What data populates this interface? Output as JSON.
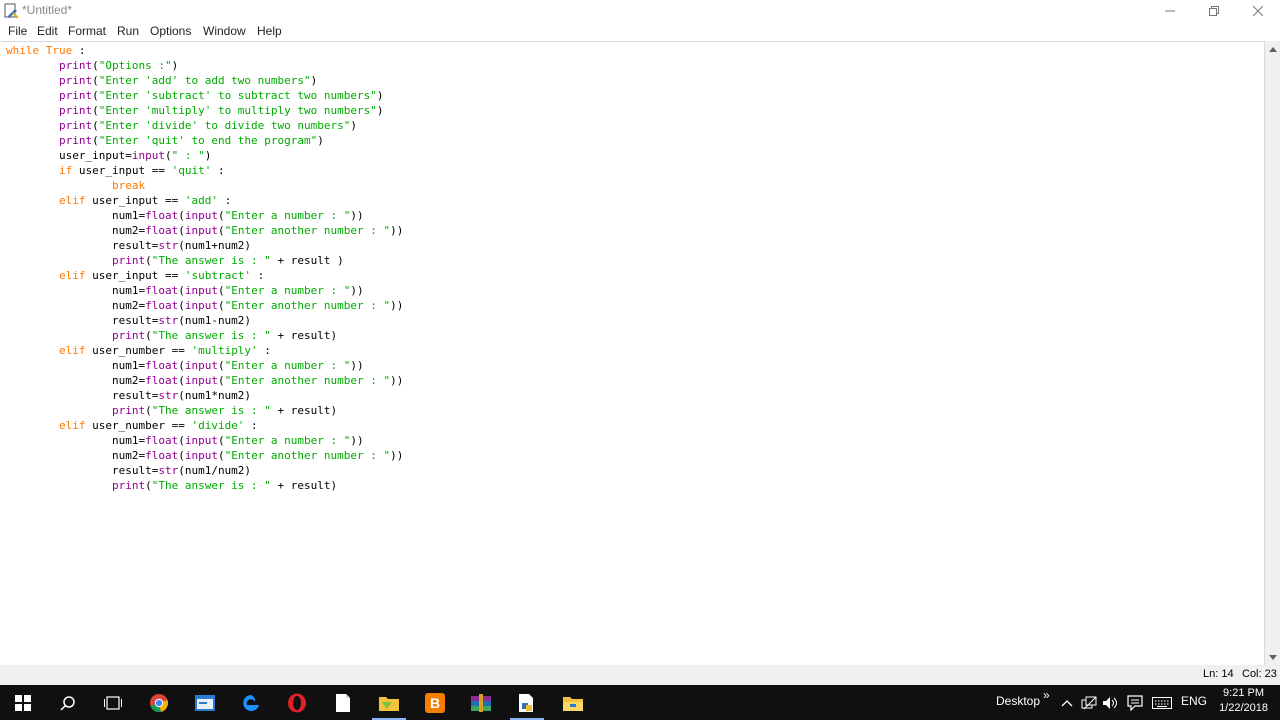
{
  "window": {
    "title": "*Untitled*"
  },
  "menu": [
    "File",
    "Edit",
    "Format",
    "Run",
    "Options",
    "Window",
    "Help"
  ],
  "code_lines": [
    [
      {
        "t": "while True",
        "c": "kw"
      },
      {
        "t": " :"
      }
    ],
    [
      {
        "t": "        "
      },
      {
        "t": "print",
        "c": "bi"
      },
      {
        "t": "("
      },
      {
        "t": "\"Options :\"",
        "c": "st"
      },
      {
        "t": ")"
      }
    ],
    [
      {
        "t": "        "
      },
      {
        "t": "print",
        "c": "bi"
      },
      {
        "t": "("
      },
      {
        "t": "\"Enter 'add' to add two numbers\"",
        "c": "st"
      },
      {
        "t": ")"
      }
    ],
    [
      {
        "t": "        "
      },
      {
        "t": "print",
        "c": "bi"
      },
      {
        "t": "("
      },
      {
        "t": "\"Enter 'subtract' to subtract two numbers\"",
        "c": "st"
      },
      {
        "t": ")"
      }
    ],
    [
      {
        "t": "        "
      },
      {
        "t": "print",
        "c": "bi"
      },
      {
        "t": "("
      },
      {
        "t": "\"Enter 'multiply' to multiply two numbers\"",
        "c": "st"
      },
      {
        "t": ")"
      }
    ],
    [
      {
        "t": "        "
      },
      {
        "t": "print",
        "c": "bi"
      },
      {
        "t": "("
      },
      {
        "t": "\"Enter 'divide' to divide two numbers\"",
        "c": "st"
      },
      {
        "t": ")"
      }
    ],
    [
      {
        "t": "        "
      },
      {
        "t": "print",
        "c": "bi"
      },
      {
        "t": "("
      },
      {
        "t": "\"Enter 'quit' to end the program\"",
        "c": "st"
      },
      {
        "t": ")"
      }
    ],
    [
      {
        "t": "        user_input="
      },
      {
        "t": "input",
        "c": "bi"
      },
      {
        "t": "("
      },
      {
        "t": "\" : \"",
        "c": "st"
      },
      {
        "t": ")"
      }
    ],
    [
      {
        "t": "        "
      },
      {
        "t": "if",
        "c": "kw"
      },
      {
        "t": " user_input == "
      },
      {
        "t": "'quit'",
        "c": "st"
      },
      {
        "t": " :"
      }
    ],
    [
      {
        "t": "                "
      },
      {
        "t": "break",
        "c": "kw"
      }
    ],
    [
      {
        "t": "        "
      },
      {
        "t": "elif",
        "c": "kw"
      },
      {
        "t": " user_input == "
      },
      {
        "t": "'add'",
        "c": "st"
      },
      {
        "t": " :"
      }
    ],
    [
      {
        "t": "                num1="
      },
      {
        "t": "float",
        "c": "bi"
      },
      {
        "t": "("
      },
      {
        "t": "input",
        "c": "bi"
      },
      {
        "t": "("
      },
      {
        "t": "\"Enter a number : \"",
        "c": "st"
      },
      {
        "t": "))"
      }
    ],
    [
      {
        "t": "                num2="
      },
      {
        "t": "float",
        "c": "bi"
      },
      {
        "t": "("
      },
      {
        "t": "input",
        "c": "bi"
      },
      {
        "t": "("
      },
      {
        "t": "\"Enter another number : \"",
        "c": "st"
      },
      {
        "t": "))"
      }
    ],
    [
      {
        "t": "                result="
      },
      {
        "t": "str",
        "c": "bi"
      },
      {
        "t": "(num1+num2)"
      }
    ],
    [
      {
        "t": "                "
      },
      {
        "t": "print",
        "c": "bi"
      },
      {
        "t": "("
      },
      {
        "t": "\"The answer is : \"",
        "c": "st"
      },
      {
        "t": " + result )"
      }
    ],
    [
      {
        "t": "        "
      },
      {
        "t": "elif",
        "c": "kw"
      },
      {
        "t": " user_input == "
      },
      {
        "t": "'subtract'",
        "c": "st"
      },
      {
        "t": " :"
      }
    ],
    [
      {
        "t": "                num1="
      },
      {
        "t": "float",
        "c": "bi"
      },
      {
        "t": "("
      },
      {
        "t": "input",
        "c": "bi"
      },
      {
        "t": "("
      },
      {
        "t": "\"Enter a number : \"",
        "c": "st"
      },
      {
        "t": "))"
      }
    ],
    [
      {
        "t": "                num2="
      },
      {
        "t": "float",
        "c": "bi"
      },
      {
        "t": "("
      },
      {
        "t": "input",
        "c": "bi"
      },
      {
        "t": "("
      },
      {
        "t": "\"Enter another number : \"",
        "c": "st"
      },
      {
        "t": "))"
      }
    ],
    [
      {
        "t": "                result="
      },
      {
        "t": "str",
        "c": "bi"
      },
      {
        "t": "(num1-num2)"
      }
    ],
    [
      {
        "t": "                "
      },
      {
        "t": "print",
        "c": "bi"
      },
      {
        "t": "("
      },
      {
        "t": "\"The answer is : \"",
        "c": "st"
      },
      {
        "t": " + result)"
      }
    ],
    [
      {
        "t": "        "
      },
      {
        "t": "elif",
        "c": "kw"
      },
      {
        "t": " user_number == "
      },
      {
        "t": "'multiply'",
        "c": "st"
      },
      {
        "t": " :"
      }
    ],
    [
      {
        "t": "                num1="
      },
      {
        "t": "float",
        "c": "bi"
      },
      {
        "t": "("
      },
      {
        "t": "input",
        "c": "bi"
      },
      {
        "t": "("
      },
      {
        "t": "\"Enter a number : \"",
        "c": "st"
      },
      {
        "t": "))"
      }
    ],
    [
      {
        "t": "                num2="
      },
      {
        "t": "float",
        "c": "bi"
      },
      {
        "t": "("
      },
      {
        "t": "input",
        "c": "bi"
      },
      {
        "t": "("
      },
      {
        "t": "\"Enter another number : \"",
        "c": "st"
      },
      {
        "t": "))"
      }
    ],
    [
      {
        "t": "                result="
      },
      {
        "t": "str",
        "c": "bi"
      },
      {
        "t": "(num1*num2)"
      }
    ],
    [
      {
        "t": "                "
      },
      {
        "t": "print",
        "c": "bi"
      },
      {
        "t": "("
      },
      {
        "t": "\"The answer is : \"",
        "c": "st"
      },
      {
        "t": " + result)"
      }
    ],
    [
      {
        "t": "        "
      },
      {
        "t": "elif",
        "c": "kw"
      },
      {
        "t": " user_number == "
      },
      {
        "t": "'divide'",
        "c": "st"
      },
      {
        "t": " :"
      }
    ],
    [
      {
        "t": "                num1="
      },
      {
        "t": "float",
        "c": "bi"
      },
      {
        "t": "("
      },
      {
        "t": "input",
        "c": "bi"
      },
      {
        "t": "("
      },
      {
        "t": "\"Enter a number : \"",
        "c": "st"
      },
      {
        "t": "))"
      }
    ],
    [
      {
        "t": "                num2="
      },
      {
        "t": "float",
        "c": "bi"
      },
      {
        "t": "("
      },
      {
        "t": "input",
        "c": "bi"
      },
      {
        "t": "("
      },
      {
        "t": "\"Enter another number : \"",
        "c": "st"
      },
      {
        "t": "))"
      }
    ],
    [
      {
        "t": "                result="
      },
      {
        "t": "str",
        "c": "bi"
      },
      {
        "t": "(num1/num2)"
      }
    ],
    [
      {
        "t": "                "
      },
      {
        "t": "print",
        "c": "bi"
      },
      {
        "t": "("
      },
      {
        "t": "\"The answer is : \"",
        "c": "st"
      },
      {
        "t": " + result)"
      }
    ]
  ],
  "syntax_colors": {
    "keyword": "#ff7700",
    "builtin": "#900090",
    "string": "#00aa00",
    "default": "#000000"
  },
  "status": {
    "line": "Ln: 14",
    "col": "Col: 23"
  },
  "taskbar": {
    "apps": [
      {
        "name": "start-icon",
        "active": false
      },
      {
        "name": "search-icon",
        "active": false
      },
      {
        "name": "task-view-icon",
        "active": false
      },
      {
        "name": "chrome-icon",
        "active": false
      },
      {
        "name": "python-idle-icon",
        "active": false
      },
      {
        "name": "edge-icon",
        "active": false
      },
      {
        "name": "opera-icon",
        "active": false
      },
      {
        "name": "notepad-icon",
        "active": false
      },
      {
        "name": "file-icon",
        "active": true
      },
      {
        "name": "blogger-icon",
        "active": false
      },
      {
        "name": "archive-icon",
        "active": false
      },
      {
        "name": "python-file-icon",
        "active": true
      },
      {
        "name": "file-explorer-icon",
        "active": false
      }
    ],
    "desktop_label": "Desktop",
    "language": "ENG",
    "time": "9:21 PM",
    "date": "1/22/2018"
  }
}
